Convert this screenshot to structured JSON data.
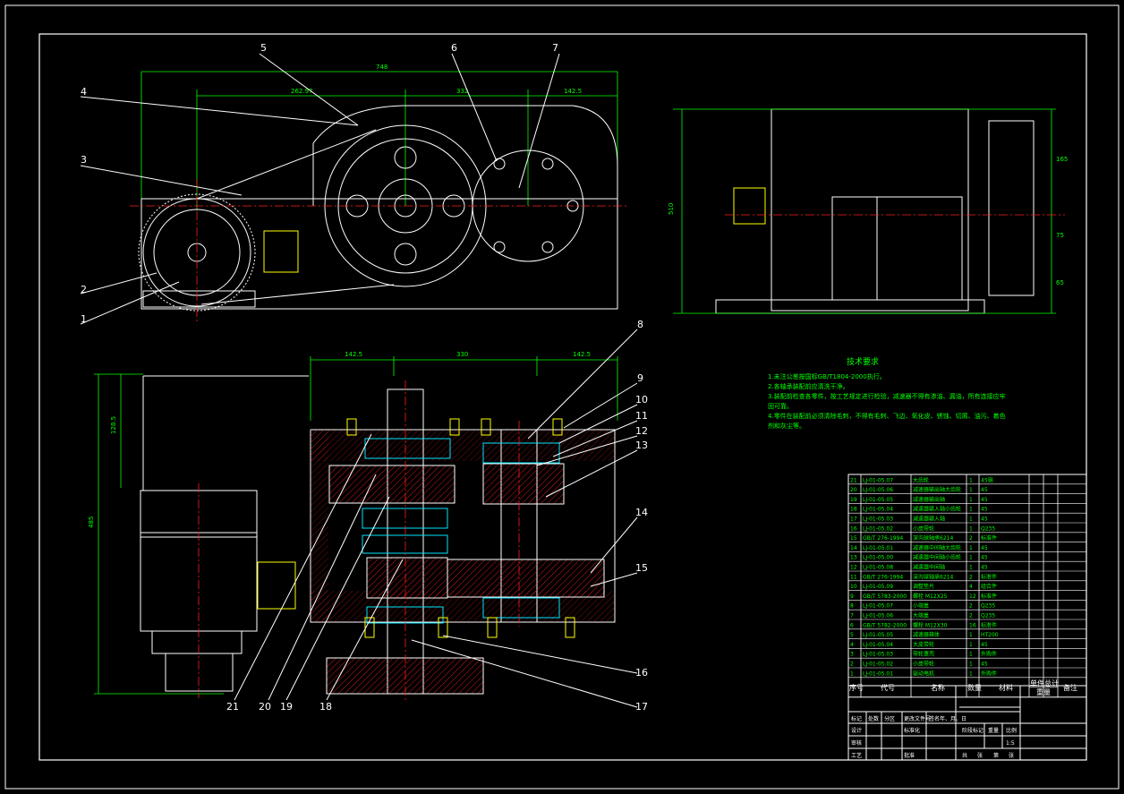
{
  "drawing": {
    "part_labels": [
      "1",
      "2",
      "3",
      "4",
      "5",
      "6",
      "7",
      "8",
      "9",
      "10",
      "11",
      "12",
      "13",
      "14",
      "15",
      "16",
      "17",
      "18",
      "19",
      "20",
      "21"
    ],
    "dims": {
      "front_total": "748",
      "front_left": "262.97",
      "front_mid": "332",
      "front_right": "142.5",
      "plan_left": "142.5",
      "plan_mid": "330",
      "plan_right": "142.5",
      "plan_height": "485",
      "plan_sub": "128.5",
      "side_height": "510",
      "side_a": "165",
      "side_b": "75",
      "side_c": "65"
    }
  },
  "tech": {
    "title": "技术要求",
    "lines": [
      "1.未注公差按国标GB/T1804-2000执行。",
      "2.各轴承装配前应清洗干净。",
      "3.装配前检查各零件，按工艺规定进行检验，减速器不得有渗油、漏油，所有连接应牢",
      "  固可靠。",
      "4.零件在装配前必须清除毛刺，不得有毛刺、飞边、氧化皮、锈蚀、切屑、油污、着色",
      "  剂和灰尘等。"
    ]
  },
  "bom": {
    "header": {
      "no": "序号",
      "code": "代号",
      "name": "名称",
      "qty": "数量",
      "mat": "材料",
      "w1": "单件",
      "w2": "总计",
      "weight": "重量",
      "note": "备注"
    },
    "rows": [
      {
        "no": "21",
        "code": "LJ-01-05.07",
        "name": "大齿轮",
        "qty": "1",
        "mat": "45钢"
      },
      {
        "no": "20",
        "code": "LJ-01-05.06",
        "name": "减速器输出轴大齿轮",
        "qty": "1",
        "mat": "45"
      },
      {
        "no": "19",
        "code": "LJ-01-05.05",
        "name": "减速器输出轴",
        "qty": "1",
        "mat": "45"
      },
      {
        "no": "18",
        "code": "LJ-01-05.04",
        "name": "减速器输入轴小齿轮",
        "qty": "1",
        "mat": "45"
      },
      {
        "no": "17",
        "code": "LJ-01-05.03",
        "name": "减速器输入轴",
        "qty": "1",
        "mat": "45"
      },
      {
        "no": "16",
        "code": "LJ-01-05.02",
        "name": "小皮带轮",
        "qty": "1",
        "mat": "Q235"
      },
      {
        "no": "15",
        "code": "GB/T 276-1994",
        "name": "深沟球轴承6214",
        "qty": "2",
        "mat": "标准件"
      },
      {
        "no": "14",
        "code": "LJ-01-05.01",
        "name": "减速器中间轴大齿轮",
        "qty": "1",
        "mat": "45"
      },
      {
        "no": "13",
        "code": "LJ-01-05.00",
        "name": "减速器中间轴小齿轮",
        "qty": "1",
        "mat": "45"
      },
      {
        "no": "12",
        "code": "LJ-01-05.08",
        "name": "减速器中间轴",
        "qty": "1",
        "mat": "45"
      },
      {
        "no": "11",
        "code": "GB/T 276-1994",
        "name": "深沟球轴承6214",
        "qty": "2",
        "mat": "标准件"
      },
      {
        "no": "10",
        "code": "LJ-01-05.09",
        "name": "调整垫片",
        "qty": "4",
        "mat": "组合件"
      },
      {
        "no": "9",
        "code": "GB/T 5783-2000",
        "name": "螺栓 M12X25",
        "qty": "12",
        "mat": "标准件"
      },
      {
        "no": "8",
        "code": "LJ-01-05.07",
        "name": "小端盖",
        "qty": "2",
        "mat": "Q235"
      },
      {
        "no": "7",
        "code": "LJ-01-05.06",
        "name": "大端盖",
        "qty": "2",
        "mat": "Q235"
      },
      {
        "no": "6",
        "code": "GB/T 5782-2000",
        "name": "螺栓 M12X30",
        "qty": "16",
        "mat": "标准件"
      },
      {
        "no": "5",
        "code": "LJ-01-05.05",
        "name": "减速器箱体",
        "qty": "1",
        "mat": "HT200"
      },
      {
        "no": "4",
        "code": "LJ-01-05.04",
        "name": "大皮带轮",
        "qty": "1",
        "mat": "45"
      },
      {
        "no": "3",
        "code": "LJ-01-05.03",
        "name": "带轮罩壳",
        "qty": "1",
        "mat": "外购件"
      },
      {
        "no": "2",
        "code": "LJ-01-05.02",
        "name": "小皮带轮",
        "qty": "1",
        "mat": "45"
      },
      {
        "no": "1",
        "code": "LJ-01-05.01",
        "name": "驱动电机",
        "qty": "1",
        "mat": "外购件"
      }
    ]
  },
  "titleblock": {
    "mark": "标记",
    "count": "处数",
    "zone": "分区",
    "change_no": "更改文件号",
    "sign": "签名",
    "date": "年、月、日",
    "design": "设计",
    "std": "标准化",
    "stage": "阶段标记",
    "weight": "重量",
    "scale": "比例",
    "check": "审核",
    "process": "工艺",
    "approve": "批准",
    "scale_val": "1:5",
    "sheet_total": "共",
    "sheet_label": "张",
    "sheet_no": "第",
    "sheet_label2": "张"
  }
}
